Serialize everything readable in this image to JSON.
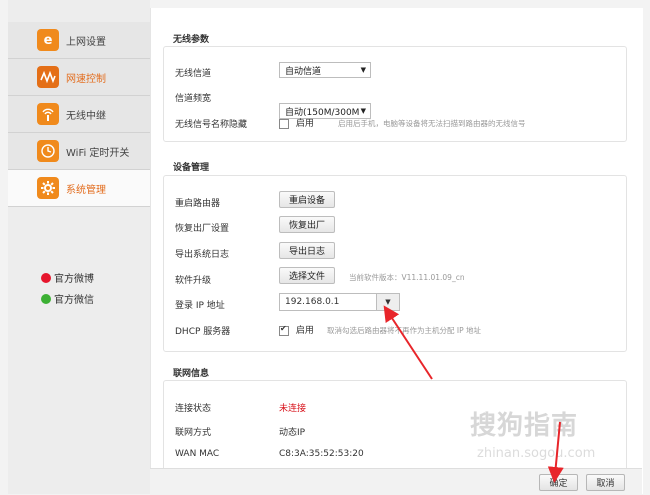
{
  "sidebar": {
    "items": [
      {
        "label": "上网设置",
        "icon": "ie-icon"
      },
      {
        "label": "网速控制",
        "icon": "speed-wave-icon"
      },
      {
        "label": "无线中继",
        "icon": "wireless-repeater-icon"
      },
      {
        "label": "WiFi 定时开关",
        "icon": "wifi-timer-icon"
      },
      {
        "label": "系统管理",
        "icon": "system-gear-icon"
      }
    ],
    "weibo": "官方微博",
    "wechat": "官方微信"
  },
  "wireless": {
    "title": "无线参数",
    "channel_label": "无线信道",
    "channel_value": "自动信道",
    "bandwidth_label": "信道频宽",
    "bandwidth_value": "自动(150M/300M",
    "hide_label": "无线信号名称隐藏",
    "hide_option": "启用",
    "hide_hint": "启用后手机，电脑等设备将无法扫描到路由器的无线信号"
  },
  "device": {
    "title": "设备管理",
    "reboot_label": "重启路由器",
    "reboot_btn": "重启设备",
    "reset_label": "恢复出厂设置",
    "reset_btn": "恢复出厂",
    "log_label": "导出系统日志",
    "log_btn": "导出日志",
    "upgrade_label": "软件升级",
    "upgrade_btn": "选择文件",
    "version_text": "当前软件版本：V11.11.01.09_cn",
    "ip_label": "登录 IP 地址",
    "ip_value": "192.168.0.1",
    "dhcp_label": "DHCP 服务器",
    "dhcp_option": "启用",
    "dhcp_hint": "取消勾选后路由器将不再作为主机分配 IP 地址"
  },
  "network": {
    "title": "联网信息",
    "status_label": "连接状态",
    "status_value": "未连接",
    "mode_label": "联网方式",
    "mode_value": "动态IP",
    "mac_label": "WAN MAC",
    "mac_value": "C8:3A:35:52:53:20"
  },
  "footer": {
    "ok": "确定",
    "cancel": "取消"
  },
  "watermark": {
    "text": "搜狗指南",
    "url": "zhinan.sogou.com"
  },
  "colors": {
    "accent": "#e36d1e",
    "alert_red": "#d8121b",
    "arrow_red": "#e8252a"
  }
}
